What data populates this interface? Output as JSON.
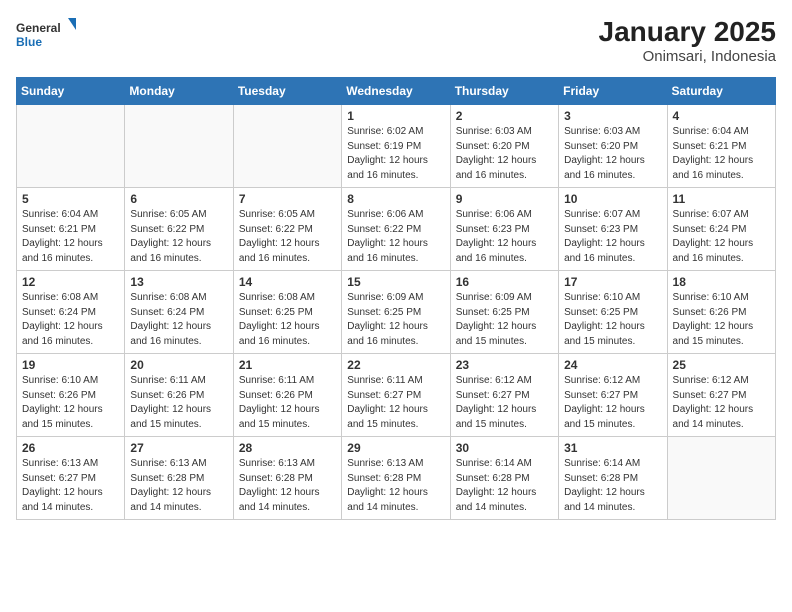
{
  "header": {
    "logo_general": "General",
    "logo_blue": "Blue",
    "title": "January 2025",
    "subtitle": "Onimsari, Indonesia"
  },
  "calendar": {
    "days_of_week": [
      "Sunday",
      "Monday",
      "Tuesday",
      "Wednesday",
      "Thursday",
      "Friday",
      "Saturday"
    ],
    "weeks": [
      [
        {
          "day": "",
          "info": ""
        },
        {
          "day": "",
          "info": ""
        },
        {
          "day": "",
          "info": ""
        },
        {
          "day": "1",
          "info": "Sunrise: 6:02 AM\nSunset: 6:19 PM\nDaylight: 12 hours\nand 16 minutes."
        },
        {
          "day": "2",
          "info": "Sunrise: 6:03 AM\nSunset: 6:20 PM\nDaylight: 12 hours\nand 16 minutes."
        },
        {
          "day": "3",
          "info": "Sunrise: 6:03 AM\nSunset: 6:20 PM\nDaylight: 12 hours\nand 16 minutes."
        },
        {
          "day": "4",
          "info": "Sunrise: 6:04 AM\nSunset: 6:21 PM\nDaylight: 12 hours\nand 16 minutes."
        }
      ],
      [
        {
          "day": "5",
          "info": "Sunrise: 6:04 AM\nSunset: 6:21 PM\nDaylight: 12 hours\nand 16 minutes."
        },
        {
          "day": "6",
          "info": "Sunrise: 6:05 AM\nSunset: 6:22 PM\nDaylight: 12 hours\nand 16 minutes."
        },
        {
          "day": "7",
          "info": "Sunrise: 6:05 AM\nSunset: 6:22 PM\nDaylight: 12 hours\nand 16 minutes."
        },
        {
          "day": "8",
          "info": "Sunrise: 6:06 AM\nSunset: 6:22 PM\nDaylight: 12 hours\nand 16 minutes."
        },
        {
          "day": "9",
          "info": "Sunrise: 6:06 AM\nSunset: 6:23 PM\nDaylight: 12 hours\nand 16 minutes."
        },
        {
          "day": "10",
          "info": "Sunrise: 6:07 AM\nSunset: 6:23 PM\nDaylight: 12 hours\nand 16 minutes."
        },
        {
          "day": "11",
          "info": "Sunrise: 6:07 AM\nSunset: 6:24 PM\nDaylight: 12 hours\nand 16 minutes."
        }
      ],
      [
        {
          "day": "12",
          "info": "Sunrise: 6:08 AM\nSunset: 6:24 PM\nDaylight: 12 hours\nand 16 minutes."
        },
        {
          "day": "13",
          "info": "Sunrise: 6:08 AM\nSunset: 6:24 PM\nDaylight: 12 hours\nand 16 minutes."
        },
        {
          "day": "14",
          "info": "Sunrise: 6:08 AM\nSunset: 6:25 PM\nDaylight: 12 hours\nand 16 minutes."
        },
        {
          "day": "15",
          "info": "Sunrise: 6:09 AM\nSunset: 6:25 PM\nDaylight: 12 hours\nand 16 minutes."
        },
        {
          "day": "16",
          "info": "Sunrise: 6:09 AM\nSunset: 6:25 PM\nDaylight: 12 hours\nand 15 minutes."
        },
        {
          "day": "17",
          "info": "Sunrise: 6:10 AM\nSunset: 6:25 PM\nDaylight: 12 hours\nand 15 minutes."
        },
        {
          "day": "18",
          "info": "Sunrise: 6:10 AM\nSunset: 6:26 PM\nDaylight: 12 hours\nand 15 minutes."
        }
      ],
      [
        {
          "day": "19",
          "info": "Sunrise: 6:10 AM\nSunset: 6:26 PM\nDaylight: 12 hours\nand 15 minutes."
        },
        {
          "day": "20",
          "info": "Sunrise: 6:11 AM\nSunset: 6:26 PM\nDaylight: 12 hours\nand 15 minutes."
        },
        {
          "day": "21",
          "info": "Sunrise: 6:11 AM\nSunset: 6:26 PM\nDaylight: 12 hours\nand 15 minutes."
        },
        {
          "day": "22",
          "info": "Sunrise: 6:11 AM\nSunset: 6:27 PM\nDaylight: 12 hours\nand 15 minutes."
        },
        {
          "day": "23",
          "info": "Sunrise: 6:12 AM\nSunset: 6:27 PM\nDaylight: 12 hours\nand 15 minutes."
        },
        {
          "day": "24",
          "info": "Sunrise: 6:12 AM\nSunset: 6:27 PM\nDaylight: 12 hours\nand 15 minutes."
        },
        {
          "day": "25",
          "info": "Sunrise: 6:12 AM\nSunset: 6:27 PM\nDaylight: 12 hours\nand 14 minutes."
        }
      ],
      [
        {
          "day": "26",
          "info": "Sunrise: 6:13 AM\nSunset: 6:27 PM\nDaylight: 12 hours\nand 14 minutes."
        },
        {
          "day": "27",
          "info": "Sunrise: 6:13 AM\nSunset: 6:28 PM\nDaylight: 12 hours\nand 14 minutes."
        },
        {
          "day": "28",
          "info": "Sunrise: 6:13 AM\nSunset: 6:28 PM\nDaylight: 12 hours\nand 14 minutes."
        },
        {
          "day": "29",
          "info": "Sunrise: 6:13 AM\nSunset: 6:28 PM\nDaylight: 12 hours\nand 14 minutes."
        },
        {
          "day": "30",
          "info": "Sunrise: 6:14 AM\nSunset: 6:28 PM\nDaylight: 12 hours\nand 14 minutes."
        },
        {
          "day": "31",
          "info": "Sunrise: 6:14 AM\nSunset: 6:28 PM\nDaylight: 12 hours\nand 14 minutes."
        },
        {
          "day": "",
          "info": ""
        }
      ]
    ]
  }
}
